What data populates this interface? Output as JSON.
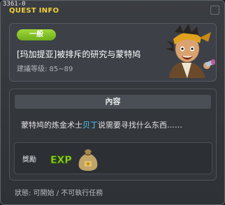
{
  "window": {
    "id": "3361-0",
    "title": "QUEST INFO"
  },
  "header": {
    "badge": "一般",
    "quest_title": "[玛加提亚]被排斥的研究与蒙特鸠",
    "level": "建議等级: 85~89"
  },
  "content": {
    "heading": "內容",
    "description_before": "蒙特鸠的炼金术士",
    "description_highlight": "贝丁",
    "description_after": "说需要寻找什么东西……",
    "reward_label": "獎勵",
    "reward_exp_text": "EXP"
  },
  "status": {
    "text": "狀態: 可開始 / 不可執行任務"
  },
  "colors": {
    "title": "#f2d13a",
    "badge": "#8cc63f",
    "highlight": "#4ecbff"
  }
}
